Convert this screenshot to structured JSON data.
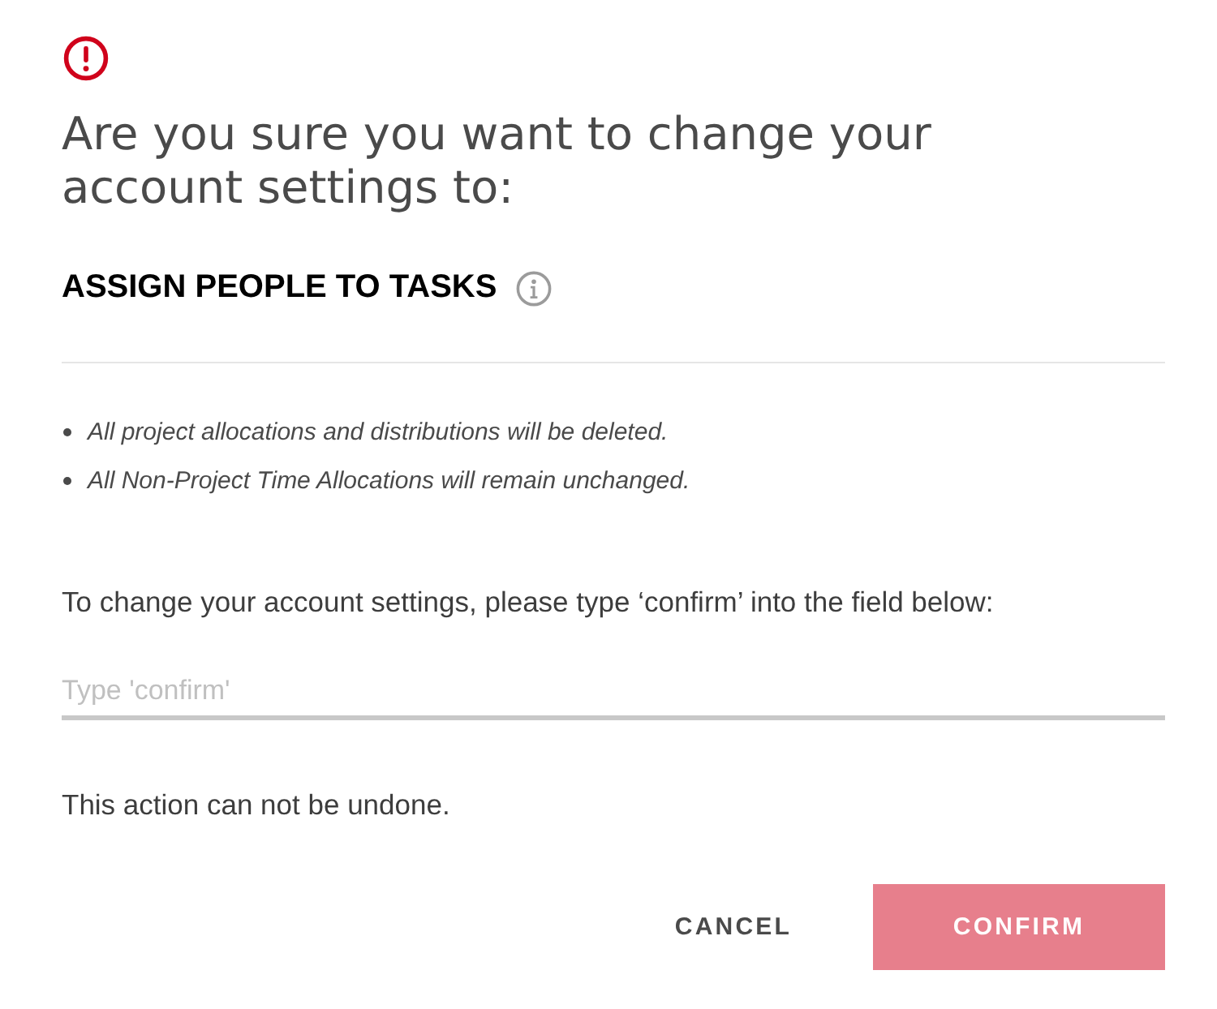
{
  "alert": {
    "title": "Are you sure you want to change your account settings to:"
  },
  "setting": {
    "name": "ASSIGN PEOPLE TO TASKS"
  },
  "consequences": [
    "All project allocations and distributions will be deleted.",
    "All Non-Project Time Allocations will remain unchanged."
  ],
  "instruction": "To change your account settings, please type ‘confirm’ into the field below:",
  "confirm_field": {
    "placeholder": "Type 'confirm'"
  },
  "warning": "This action can not be undone.",
  "buttons": [
    {
      "label": "CANCEL",
      "kind": "text",
      "disabled": false
    },
    {
      "label": "CONFIRM",
      "kind": "primary",
      "disabled": true
    }
  ]
}
